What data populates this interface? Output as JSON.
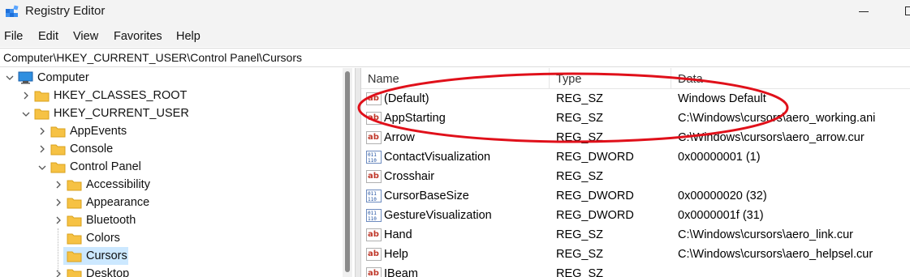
{
  "window": {
    "title": "Registry Editor"
  },
  "menu": [
    "File",
    "Edit",
    "View",
    "Favorites",
    "Help"
  ],
  "address": "Computer\\HKEY_CURRENT_USER\\Control Panel\\Cursors",
  "tree": [
    {
      "label": "Computer",
      "icon": "computer-icon",
      "expanded": true
    },
    {
      "label": "HKEY_CLASSES_ROOT",
      "icon": "folder-icon",
      "expanded": false
    },
    {
      "label": "HKEY_CURRENT_USER",
      "icon": "folder-icon",
      "expanded": true
    },
    {
      "label": "AppEvents",
      "icon": "folder-icon",
      "expanded": false
    },
    {
      "label": "Console",
      "icon": "folder-icon",
      "expanded": false
    },
    {
      "label": "Control Panel",
      "icon": "folder-icon",
      "expanded": true
    },
    {
      "label": "Accessibility",
      "icon": "folder-icon",
      "expanded": false
    },
    {
      "label": "Appearance",
      "icon": "folder-icon",
      "expanded": false
    },
    {
      "label": "Bluetooth",
      "icon": "folder-icon",
      "expanded": false
    },
    {
      "label": "Colors",
      "icon": "folder-icon"
    },
    {
      "label": "Cursors",
      "icon": "folder-icon",
      "selected": true
    },
    {
      "label": "Desktop",
      "icon": "folder-icon",
      "expanded": false
    }
  ],
  "columns": [
    "Name",
    "Type",
    "Data"
  ],
  "values": [
    {
      "name": "(Default)",
      "type": "REG_SZ",
      "data": "Windows Default",
      "icon": "string-value-icon"
    },
    {
      "name": "AppStarting",
      "type": "REG_SZ",
      "data": "C:\\Windows\\cursors\\aero_working.ani",
      "icon": "string-value-icon"
    },
    {
      "name": "Arrow",
      "type": "REG_SZ",
      "data": "C:\\Windows\\cursors\\aero_arrow.cur",
      "icon": "string-value-icon"
    },
    {
      "name": "ContactVisualization",
      "type": "REG_DWORD",
      "data": "0x00000001 (1)",
      "icon": "dword-value-icon"
    },
    {
      "name": "Crosshair",
      "type": "REG_SZ",
      "data": "",
      "icon": "string-value-icon"
    },
    {
      "name": "CursorBaseSize",
      "type": "REG_DWORD",
      "data": "0x00000020 (32)",
      "icon": "dword-value-icon"
    },
    {
      "name": "GestureVisualization",
      "type": "REG_DWORD",
      "data": "0x0000001f (31)",
      "icon": "dword-value-icon"
    },
    {
      "name": "Hand",
      "type": "REG_SZ",
      "data": "C:\\Windows\\cursors\\aero_link.cur",
      "icon": "string-value-icon"
    },
    {
      "name": "Help",
      "type": "REG_SZ",
      "data": "C:\\Windows\\cursors\\aero_helpsel.cur",
      "icon": "string-value-icon"
    },
    {
      "name": "IBeam",
      "type": "REG_SZ",
      "data": "",
      "icon": "string-value-icon"
    }
  ],
  "colors": {
    "annotation": "#e0101a",
    "selection": "#cce8ff",
    "folder": "#f6c244"
  }
}
